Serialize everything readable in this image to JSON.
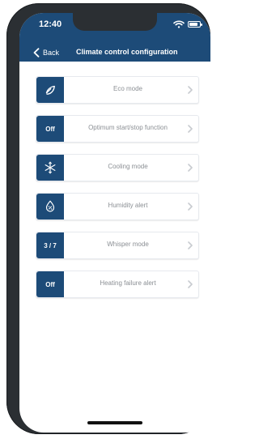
{
  "status_bar": {
    "time": "12:40",
    "icons": [
      "wifi-icon",
      "battery-icon"
    ]
  },
  "nav": {
    "back_label": "Back",
    "title": "Climate control configuration"
  },
  "items": [
    {
      "tile_text": "",
      "tile_icon": "eco-leaf-icon",
      "label": "Eco mode"
    },
    {
      "tile_text": "Off",
      "tile_icon": "",
      "label": "Optimum start/stop function"
    },
    {
      "tile_text": "",
      "tile_icon": "snowflake-icon",
      "label": "Cooling mode"
    },
    {
      "tile_text": "",
      "tile_icon": "humidity-drop-icon",
      "label": "Humidity alert"
    },
    {
      "tile_text": "3 / 7",
      "tile_icon": "",
      "label": "Whisper mode"
    },
    {
      "tile_text": "Off",
      "tile_icon": "",
      "label": "Heating failure alert"
    }
  ],
  "colors": {
    "header": "#1d4b78",
    "label": "#8b8f94"
  }
}
